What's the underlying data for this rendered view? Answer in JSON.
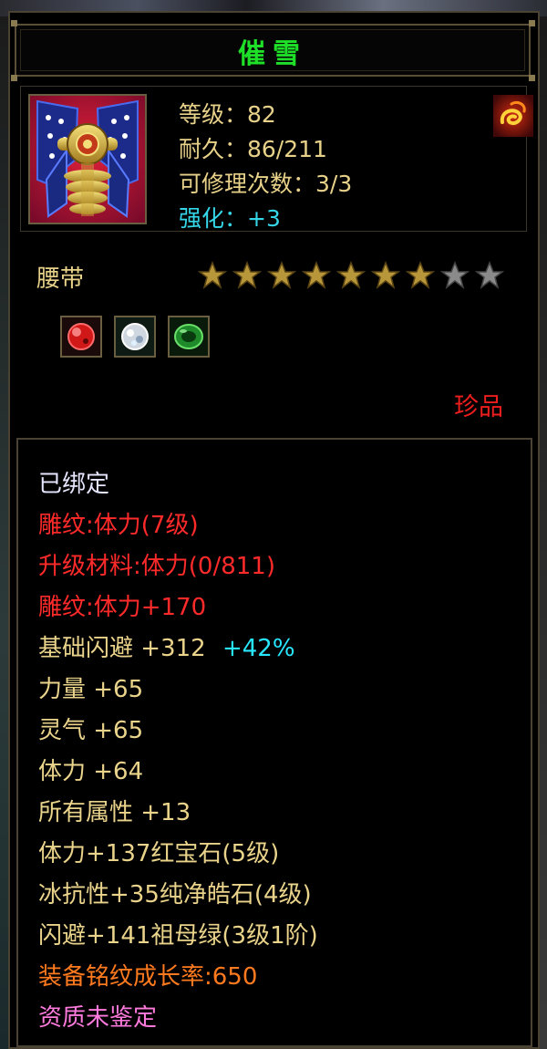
{
  "item": {
    "title": "催雪",
    "stats": [
      {
        "label": "等级：82"
      },
      {
        "label": "耐久：86/211"
      },
      {
        "label": "可修理次数：3/3"
      },
      {
        "label": "强化：+3"
      }
    ],
    "type": "腰带",
    "stars_filled": 7,
    "stars_total": 9,
    "rarity": "珍品"
  },
  "gems": [
    "ruby-gem-icon",
    "diamond-gem-icon",
    "jade-gem-icon"
  ],
  "attributes": [
    {
      "text": "已绑定",
      "color": "#e6e6ff"
    },
    {
      "text": "雕纹:体力(7级)",
      "color": "#ff2a2a"
    },
    {
      "text": "升级材料:体力(0/811)",
      "color": "#ff2a2a"
    },
    {
      "text": "雕纹:体力+170",
      "color": "#ff2a2a"
    },
    {
      "text": "基础闪避 +312",
      "extra": "+42%",
      "color": "#ead38a"
    },
    {
      "text": "力量 +65",
      "color": "#ead38a"
    },
    {
      "text": "灵气 +65",
      "color": "#ead38a"
    },
    {
      "text": "体力 +64",
      "color": "#ead38a"
    },
    {
      "text": "所有属性 +13",
      "color": "#ead38a"
    },
    {
      "text": "体力+137红宝石(5级)",
      "color": "#ead38a"
    },
    {
      "text": "冰抗性+35纯净皓石(4级)",
      "color": "#ead38a"
    },
    {
      "text": "闪避+141祖母绿(3级1阶)",
      "color": "#ead38a"
    },
    {
      "text": "装备铭纹成长率:650",
      "color": "#ff7a1e"
    },
    {
      "text": "资质未鉴定",
      "color": "#ff7adc"
    }
  ],
  "colors": {
    "title": "#1fe028",
    "border": "#5a4e36",
    "star_filled": "#b8963a",
    "star_empty": "#8a8a8a"
  }
}
